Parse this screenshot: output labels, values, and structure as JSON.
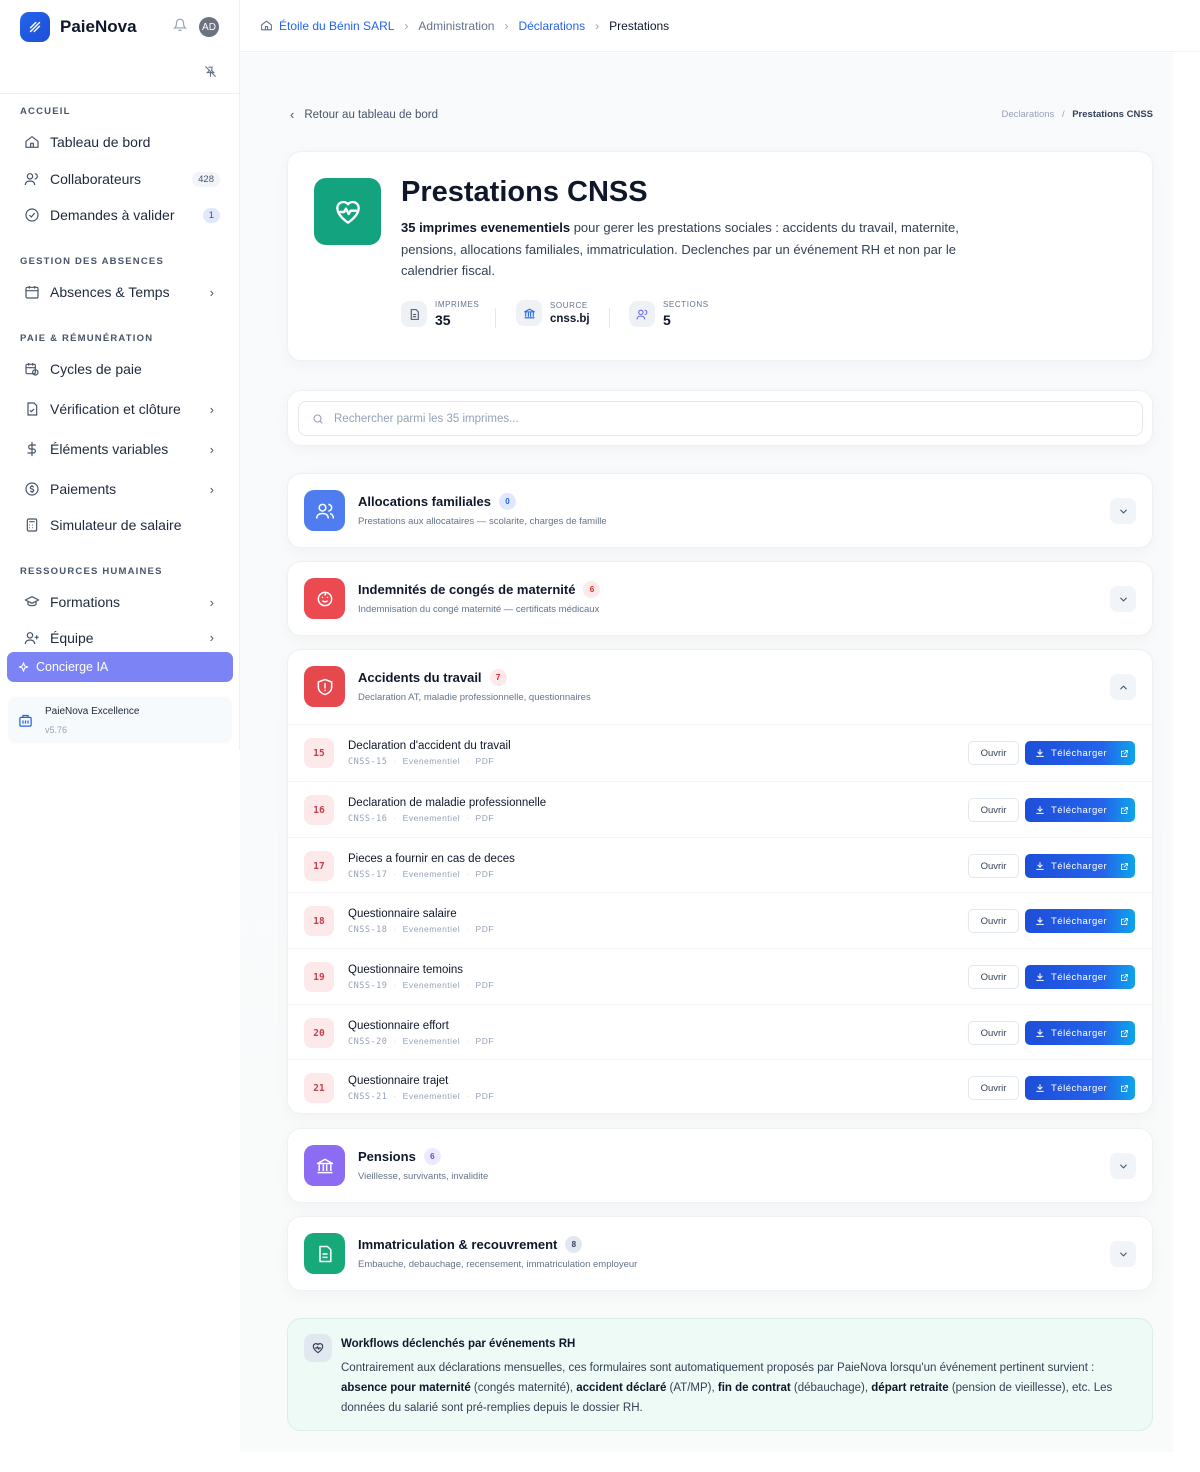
{
  "brand": {
    "name": "PaieNova",
    "avatar": "AD"
  },
  "sidebar": {
    "sections": [
      "ACCUEIL",
      "GESTION DES ABSENCES",
      "PAIE & RÉMUNÉRATION",
      "RESSOURCES HUMAINES"
    ],
    "items": [
      {
        "label": "Tableau de bord",
        "icon": "home-icon"
      },
      {
        "label": "Collaborateurs",
        "icon": "users-icon",
        "badge": "428"
      },
      {
        "label": "Demandes à valider",
        "icon": "check-circle-icon",
        "badge": "1"
      },
      {
        "label": "Absences & Temps",
        "icon": "calendar-icon",
        "chevron": "›"
      },
      {
        "label": "Cycles de paie",
        "icon": "calendar-clock-icon"
      },
      {
        "label": "Vérification et clôture",
        "icon": "file-check-icon",
        "chevron": "›"
      },
      {
        "label": "Éléments variables",
        "icon": "dollar-icon",
        "chevron": "›"
      },
      {
        "label": "Paiements",
        "icon": "coin-icon",
        "chevron": "›"
      },
      {
        "label": "Simulateur de salaire",
        "icon": "calculator-icon"
      },
      {
        "label": "Formations",
        "icon": "graduation-icon",
        "chevron": "›"
      },
      {
        "label": "Équipe",
        "icon": "user-plus-icon",
        "chevron": "›"
      }
    ],
    "concierge": "Concierge IA",
    "plan": {
      "name": "PaieNova Excellence",
      "version": "v5.76"
    }
  },
  "breadcrumb": [
    "Étoile du Bénin SARL",
    "Administration",
    "Déclarations",
    "Prestations"
  ],
  "page": {
    "back": "Retour au tableau de bord",
    "mini_crumb": {
      "parent": "Declarations",
      "sep": "/",
      "current": "Prestations CNSS"
    },
    "title": "Prestations CNSS",
    "desc_bold": "35 imprimes evenementiels",
    "desc_rest": " pour gerer les prestations sociales : accidents du travail, maternite, pensions, allocations familiales, immatriculation. Declenches par un événement RH et non par le calendrier fiscal.",
    "stats": [
      {
        "label": "IMPRIMES",
        "value": "35"
      },
      {
        "label": "SOURCE",
        "value": "cnss.bj"
      },
      {
        "label": "SECTIONS",
        "value": "5"
      }
    ],
    "search_placeholder": "Rechercher parmi les 35 imprimes..."
  },
  "sections": [
    {
      "title": "Allocations familiales",
      "count": "0",
      "subtitle": "Prestations aux allocataires — scolarite, charges de famille",
      "color": "#3b82f6"
    },
    {
      "title": "Indemnités de congés de maternité",
      "count": "6",
      "subtitle": "Indemnisation du congé maternité — certificats médicaux",
      "color": "#ef4444"
    },
    {
      "title": "Accidents du travail",
      "count": "7",
      "subtitle": "Declaration AT, maladie professionnelle, questionnaires",
      "color": "#ef4444"
    },
    {
      "title": "Pensions",
      "count": "6",
      "subtitle": "Vieillesse, survivants, invalidite",
      "color": "#8b5cf6"
    },
    {
      "title": "Immatriculation & recouvrement",
      "count": "8",
      "subtitle": "Embauche, debauchage, recensement, immatriculation employeur",
      "color": "#10b981"
    }
  ],
  "forms": [
    {
      "num": "15",
      "title": "Declaration d'accident du travail",
      "code": "CNSS-15"
    },
    {
      "num": "16",
      "title": "Declaration de maladie professionnelle",
      "code": "CNSS-16"
    },
    {
      "num": "17",
      "title": "Pieces a fournir en cas de deces",
      "code": "CNSS-17"
    },
    {
      "num": "18",
      "title": "Questionnaire salaire",
      "code": "CNSS-18"
    },
    {
      "num": "19",
      "title": "Questionnaire temoins",
      "code": "CNSS-19"
    },
    {
      "num": "20",
      "title": "Questionnaire effort",
      "code": "CNSS-20"
    },
    {
      "num": "21",
      "title": "Questionnaire trajet",
      "code": "CNSS-21"
    }
  ],
  "form_meta": {
    "kind": "Evenementiel",
    "format": "PDF",
    "open_label": "Ouvrir",
    "download_label": "Télécharger"
  },
  "workflow": {
    "title": "Workflows déclenchés par événements RH",
    "p1": "Contrairement aux déclarations mensuelles, ces formulaires sont automatiquement proposés par PaieNova lorsqu'un événement pertinent survient : ",
    "b1": "absence pour maternité",
    "p2": " (congés maternité), ",
    "b2": "accident déclaré",
    "p3": " (AT/MP), ",
    "b3": "fin de contrat",
    "p4": " (débauchage), ",
    "b4": "départ retraite",
    "p5": " (pension de vieillesse), etc. Les données du salarié sont pré-remplies depuis le dossier RH."
  }
}
